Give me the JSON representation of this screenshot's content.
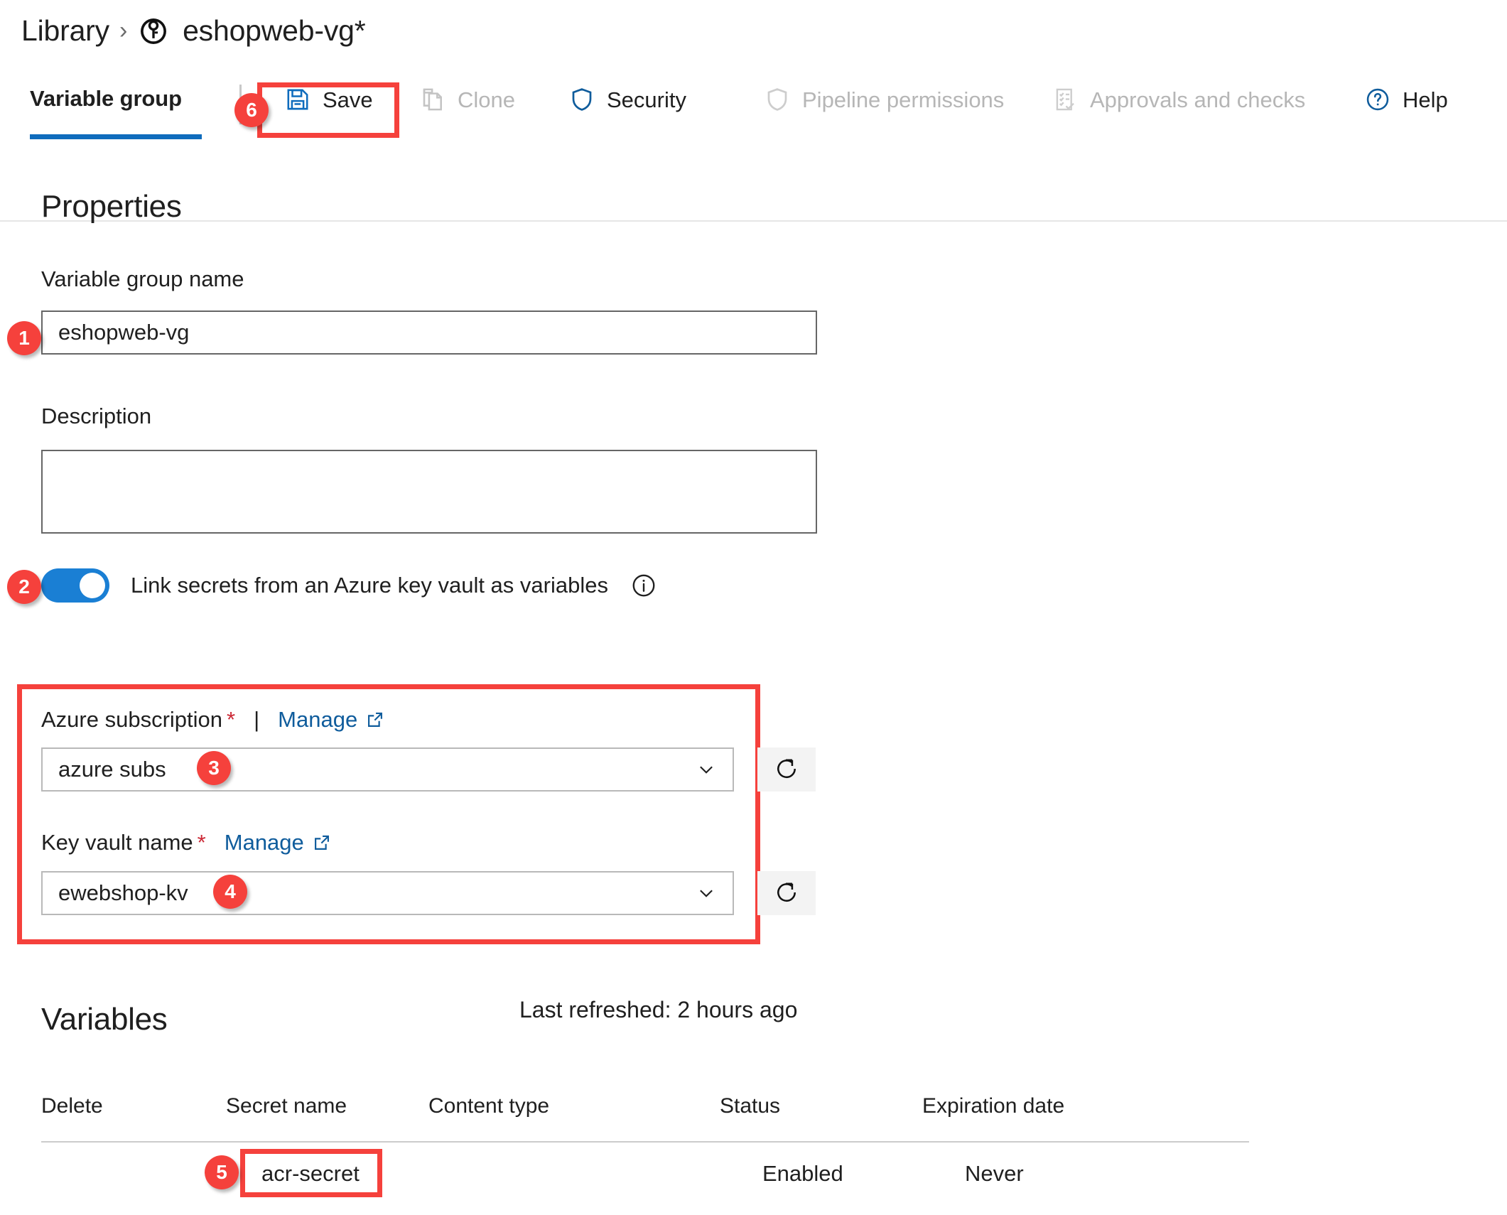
{
  "breadcrumb": {
    "root_label": "Library",
    "separator": "›",
    "icon": "key-circle-icon",
    "title": "eshopweb-vg*"
  },
  "toolbar": {
    "tab_label": "Variable group",
    "items": [
      {
        "label": "Save",
        "icon": "save-floppy-icon",
        "enabled": true,
        "highlighted": true
      },
      {
        "label": "Clone",
        "icon": "clone-copy-icon",
        "enabled": false
      },
      {
        "label": "Security",
        "icon": "shield-icon",
        "enabled": true
      },
      {
        "label": "Pipeline permissions",
        "icon": "shield-outline-icon",
        "enabled": false
      },
      {
        "label": "Approvals and checks",
        "icon": "checklist-icon",
        "enabled": false
      },
      {
        "label": "Help",
        "icon": "question-circle-icon",
        "enabled": true
      }
    ]
  },
  "properties": {
    "heading": "Properties",
    "name_label": "Variable group name",
    "name_value": "eshopweb-vg",
    "name_placeholder": "",
    "description_label": "Description",
    "description_value": "",
    "description_placeholder": "",
    "toggle_label": "Link secrets from an Azure key vault as variables",
    "toggle_on": true,
    "info_icon": "info-circle-icon"
  },
  "keyvault": {
    "subscription_label": "Azure subscription",
    "subscription_required_mark": "*",
    "pipe": "|",
    "manage_label": "Manage",
    "external_icon": "external-link-icon",
    "subscription_value": "azure subs",
    "keyvault_label": "Key vault name",
    "keyvault_required_mark": "*",
    "keyvault_value": "ewebshop-kv",
    "refresh_icon": "refresh-icon",
    "caret_icon": "chevron-down-icon"
  },
  "variables": {
    "heading": "Variables",
    "last_refreshed": "Last refreshed: 2 hours ago",
    "columns": [
      "Delete",
      "Secret name",
      "Content type",
      "Status",
      "Expiration date"
    ],
    "rows": [
      {
        "delete": "",
        "secret_name": "acr-secret",
        "content_type": "",
        "status": "Enabled",
        "expiration_date": "Never"
      }
    ]
  },
  "annotations": {
    "badges": [
      "1",
      "2",
      "3",
      "4",
      "5",
      "6"
    ],
    "highlight_color": "#f5413c",
    "badge_color": "#f5413c"
  },
  "colors": {
    "accent_blue": "#0f6cbd",
    "link_blue": "#0f5c9c",
    "toggle_blue": "#1a7fd4",
    "disabled_grey": "#b6b6b6",
    "required_red": "#cc2936"
  }
}
